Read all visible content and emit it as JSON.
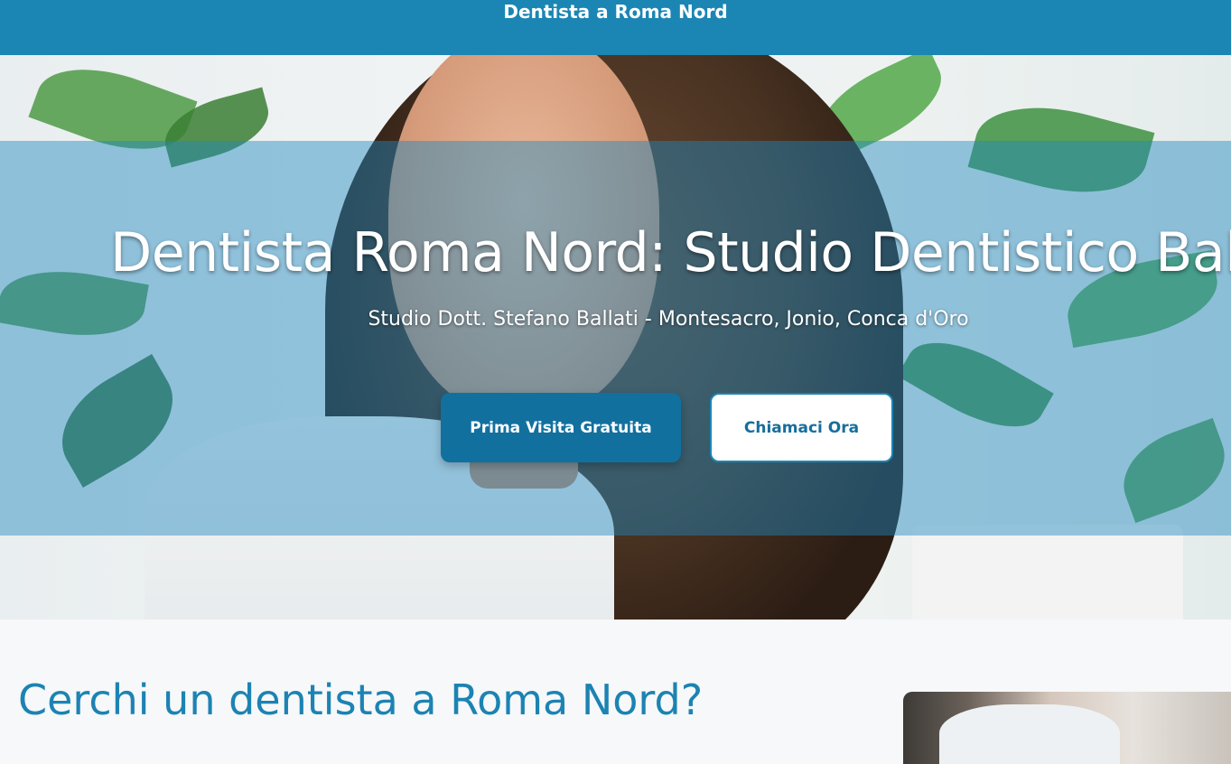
{
  "header": {
    "brand": "Dentista a Roma Nord"
  },
  "hero": {
    "title": "Dentista Roma Nord: Studio Dentistico Ballati",
    "subtitle": "Studio Dott. Stefano Ballati - Montesacro, Jonio, Conca d'Oro",
    "primary_cta": "Prima Visita Gratuita",
    "secondary_cta": "Chiamaci Ora"
  },
  "section": {
    "title": "Cerchi un dentista a Roma Nord?"
  },
  "colors": {
    "brand_blue": "#1b86b4",
    "button_blue": "#12709f",
    "overlay_blue": "rgba(30,135,190,0.45)",
    "heading_blue": "#1c83b2"
  }
}
